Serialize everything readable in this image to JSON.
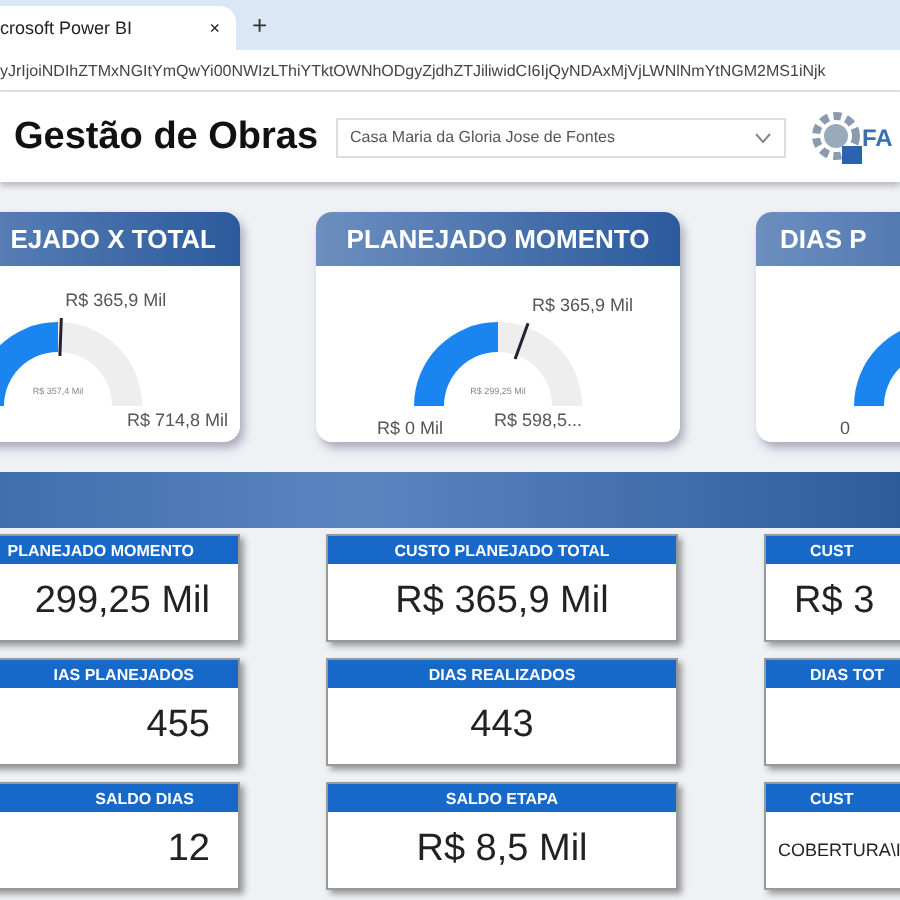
{
  "browser": {
    "tab_title": "crosoft Power BI",
    "close": "×",
    "new_tab": "+",
    "url": "yJrIjoiNDIhZTMxNGItYmQwYi00NWIzLThiYTktOWNhODgyZjdhZTJiliwidCI6IjQyNDAxMjVjLWNlNmYtNGM2MS1iNjk"
  },
  "header": {
    "title": "Gestão de Obras",
    "dropdown": {
      "value": "Casa Maria da Gloria Jose de Fontes"
    },
    "logo_text": "FA"
  },
  "gauges": [
    {
      "title": "EJADO X TOTAL",
      "target_label": "R$ 365,9 Mil",
      "center_label": "R$ 357,4 Mil",
      "max_label": "R$ 714,8 Mil"
    },
    {
      "title": "PLANEJADO MOMENTO",
      "target_label": "R$ 365,9 Mil",
      "center_label": "R$ 299,25 Mil",
      "min_label": "R$ 0 Mil",
      "max_label": "R$ 598,5..."
    },
    {
      "title": "DIAS P",
      "min_label": "0"
    }
  ],
  "kpis": [
    [
      {
        "title": "PLANEJADO MOMENTO",
        "value": "299,25 Mil"
      },
      {
        "title": "CUSTO PLANEJADO TOTAL",
        "value": "R$ 365,9 Mil"
      },
      {
        "title": "CUST",
        "value": "R$ 3"
      }
    ],
    [
      {
        "title": "IAS PLANEJADOS",
        "value": "455"
      },
      {
        "title": "DIAS REALIZADOS",
        "value": "443"
      },
      {
        "title": "DIAS TOT"
      }
    ],
    [
      {
        "title": "SALDO DIAS",
        "value": "12"
      },
      {
        "title": "SALDO ETAPA",
        "value": "R$ 8,5 Mil"
      },
      {
        "title": "CUST",
        "value": "COBERTURA\\I",
        "kind": "text"
      }
    ]
  ]
}
